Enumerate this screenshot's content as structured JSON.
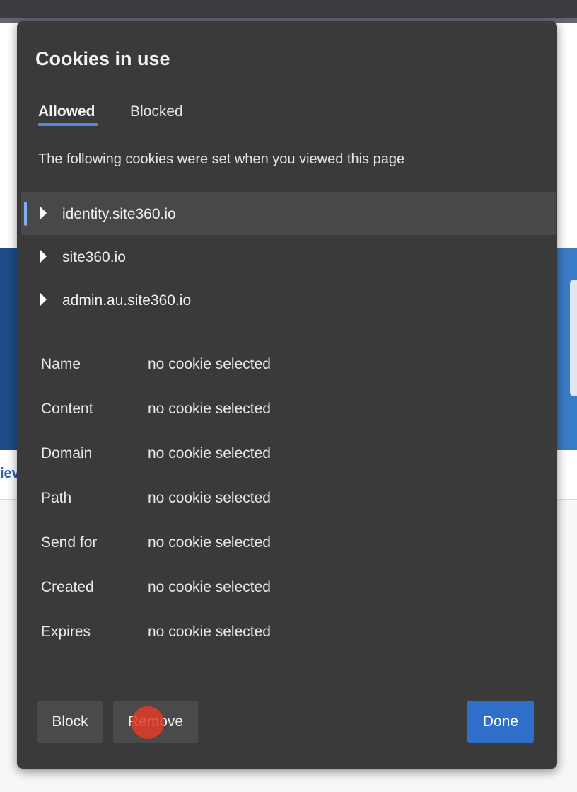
{
  "dialog": {
    "title": "Cookies in use",
    "tabs": [
      {
        "label": "Allowed",
        "active": true
      },
      {
        "label": "Blocked",
        "active": false
      }
    ],
    "description": "The following cookies were set when you viewed this page",
    "cookie_domains": [
      {
        "label": "identity.site360.io",
        "selected": true,
        "icon": "caret-right-icon"
      },
      {
        "label": "site360.io",
        "selected": false,
        "icon": "caret-right-icon"
      },
      {
        "label": "admin.au.site360.io",
        "selected": false,
        "icon": "caret-right-icon"
      }
    ],
    "details": [
      {
        "key": "Name",
        "value": "no cookie selected"
      },
      {
        "key": "Content",
        "value": "no cookie selected"
      },
      {
        "key": "Domain",
        "value": "no cookie selected"
      },
      {
        "key": "Path",
        "value": "no cookie selected"
      },
      {
        "key": "Send for",
        "value": "no cookie selected"
      },
      {
        "key": "Created",
        "value": "no cookie selected"
      },
      {
        "key": "Expires",
        "value": "no cookie selected"
      }
    ],
    "buttons": {
      "block": "Block",
      "remove": "Remove",
      "done": "Done"
    }
  },
  "background": {
    "link_fragment": "iev"
  },
  "colors": {
    "dialog_bg": "#3a3a3a",
    "accent": "#2f6fc9",
    "tab_underline": "#4f8ae0",
    "click_marker": "#e23c28"
  }
}
